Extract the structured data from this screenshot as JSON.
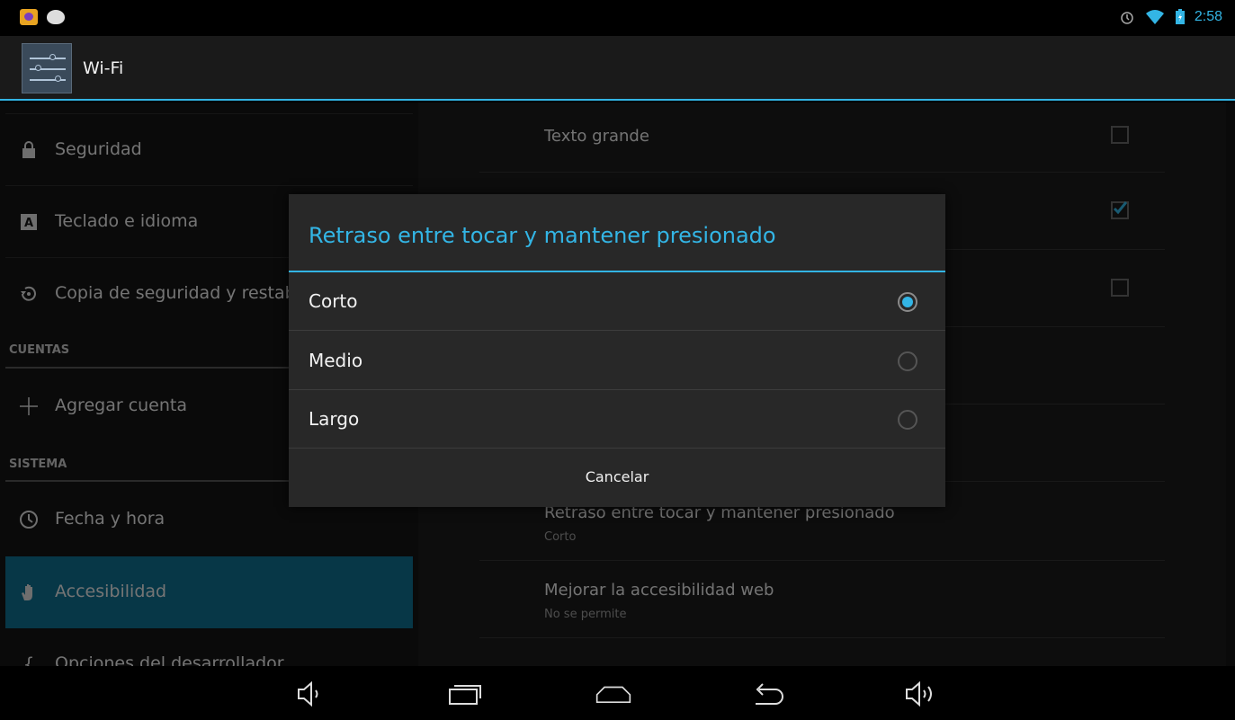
{
  "statusbar": {
    "time": "2:58",
    "icons": [
      "app-icon",
      "android-icon",
      "alarm-icon",
      "wifi-icon",
      "battery-icon"
    ]
  },
  "actionbar": {
    "title": "Wi-Fi",
    "icon": "settings-icon"
  },
  "sidebar": {
    "items": [
      {
        "label": "Seguridad",
        "icon": "lock-icon"
      },
      {
        "label": "Teclado e idioma",
        "icon": "keyboard-icon"
      },
      {
        "label": "Copia de seguridad y restablecer",
        "icon": "backup-icon"
      },
      {
        "label": "Agregar cuenta",
        "icon": "plus-icon"
      },
      {
        "label": "Fecha y hora",
        "icon": "clock-icon"
      },
      {
        "label": "Accesibilidad",
        "icon": "hand-icon"
      },
      {
        "label": "Opciones del desarrollador",
        "icon": "braces-icon"
      }
    ],
    "sections": {
      "accounts": "CUENTAS",
      "system": "SISTEMA"
    },
    "active_index": 5
  },
  "preferences": [
    {
      "title": "Texto grande",
      "checked": false
    },
    {
      "title": "Retraso entre tocar y mantener presionado",
      "summary": "Corto"
    },
    {
      "title": "Mejorar la accesibilidad web",
      "summary": "No se permite"
    }
  ],
  "dialog": {
    "title": "Retraso entre tocar y mantener presionado",
    "options": [
      {
        "label": "Corto",
        "selected": true
      },
      {
        "label": "Medio",
        "selected": false
      },
      {
        "label": "Largo",
        "selected": false
      }
    ],
    "cancel_label": "Cancelar"
  },
  "colors": {
    "accent": "#33b5e5",
    "active_item": "#0e6e8f"
  },
  "navbar": {
    "icons": [
      "volume-down-icon",
      "recent-apps-icon",
      "home-icon",
      "back-icon",
      "volume-up-icon"
    ]
  }
}
